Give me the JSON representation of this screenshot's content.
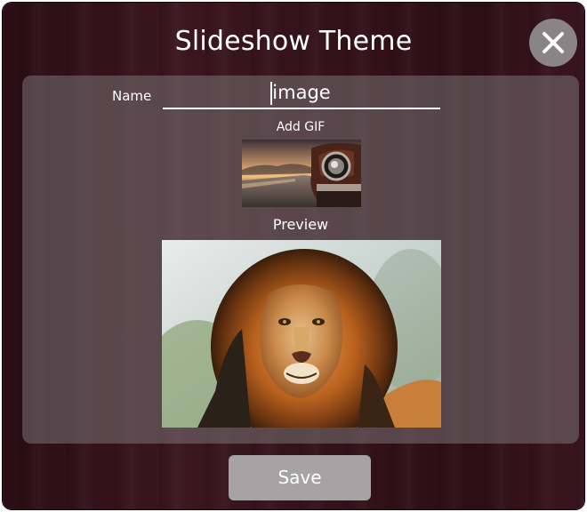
{
  "dialog": {
    "title": "Slideshow Theme",
    "close_icon": "close-icon"
  },
  "form": {
    "name_label": "Name",
    "name_value": "image",
    "add_gif_label": "Add GIF",
    "gif_thumbnail": "sunset-road-car-headlight-image",
    "preview_label": "Preview",
    "preview_image": "lion-portrait-image"
  },
  "actions": {
    "save_label": "Save"
  },
  "colors": {
    "background": "#35121b",
    "panel": "#6f6a6c",
    "button": "#a6a3a4",
    "text": "#ffffff"
  }
}
